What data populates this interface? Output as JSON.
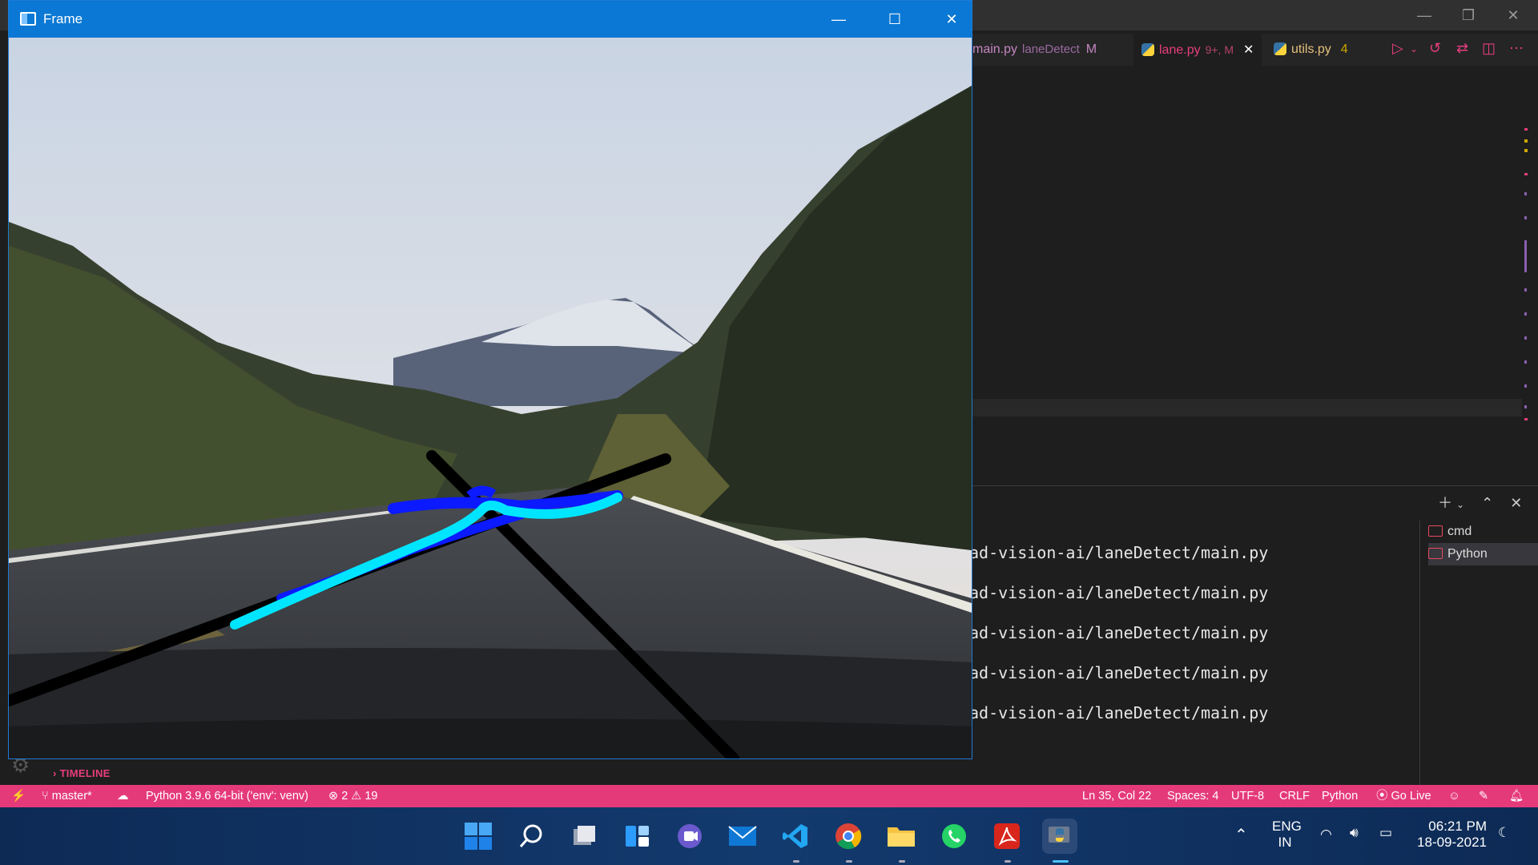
{
  "frame_window": {
    "title": "Frame"
  },
  "tabs": [
    {
      "file": "main.py",
      "folder": "laneDetect",
      "status": "M"
    },
    {
      "file": "lane.py",
      "status": "9+, M"
    },
    {
      "file": "utils.py",
      "status": "4"
    }
  ],
  "terminal": {
    "lines": [
      "ad-vision-ai/laneDetect/main.py",
      "ad-vision-ai/laneDetect/main.py",
      "ad-vision-ai/laneDetect/main.py",
      "ad-vision-ai/laneDetect/main.py",
      "ad-vision-ai/laneDetect/main.py"
    ],
    "instances": [
      "cmd",
      "Python"
    ]
  },
  "sidebar": {
    "timeline_label": "TIMELINE"
  },
  "statusbar": {
    "branch": "master*",
    "interpreter": "Python 3.9.6 64-bit ('env': venv)",
    "errors": "2",
    "warnings": "19",
    "cursor": "Ln 35, Col 22",
    "spaces": "Spaces: 4",
    "encoding": "UTF-8",
    "eol": "CRLF",
    "language": "Python",
    "golive": "Go Live"
  },
  "taskbar": {
    "apps": [
      "start-icon",
      "search-icon",
      "task-view-icon",
      "widgets-icon",
      "teams-chat-icon",
      "mail-icon",
      "vscode-icon",
      "chrome-icon",
      "file-explorer-icon",
      "whatsapp-icon",
      "acrobat-icon",
      "python-icon"
    ],
    "lang_line1": "ENG",
    "lang_line2": "IN",
    "time": "06:21 PM",
    "date": "18-09-2021"
  },
  "colors": {
    "accent": "#0a78d4",
    "status_bar": "#e53a7a",
    "lane_fit": "#00e5ff",
    "lane_points": "#0b1aff"
  }
}
